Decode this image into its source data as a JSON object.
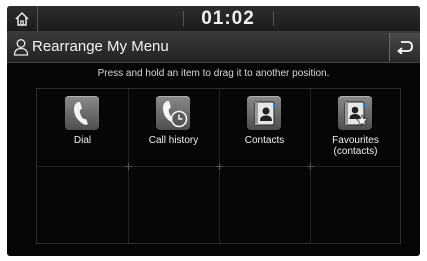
{
  "status_bar": {
    "clock": "01:02"
  },
  "header": {
    "title": "Rearrange My Menu"
  },
  "instruction": "Press and hold an item to drag it to another position.",
  "menu_items": [
    {
      "label": "Dial",
      "icon": "phone-icon"
    },
    {
      "label": "Call history",
      "icon": "call-history-icon"
    },
    {
      "label": "Contacts",
      "icon": "contacts-icon"
    },
    {
      "label_line1": "Favourites",
      "label_line2": "(contacts)",
      "icon": "favourite-contacts-icon"
    }
  ],
  "colors": {
    "background": "#060606",
    "text": "#f0f0f0",
    "bar": "#2e2e2e"
  }
}
